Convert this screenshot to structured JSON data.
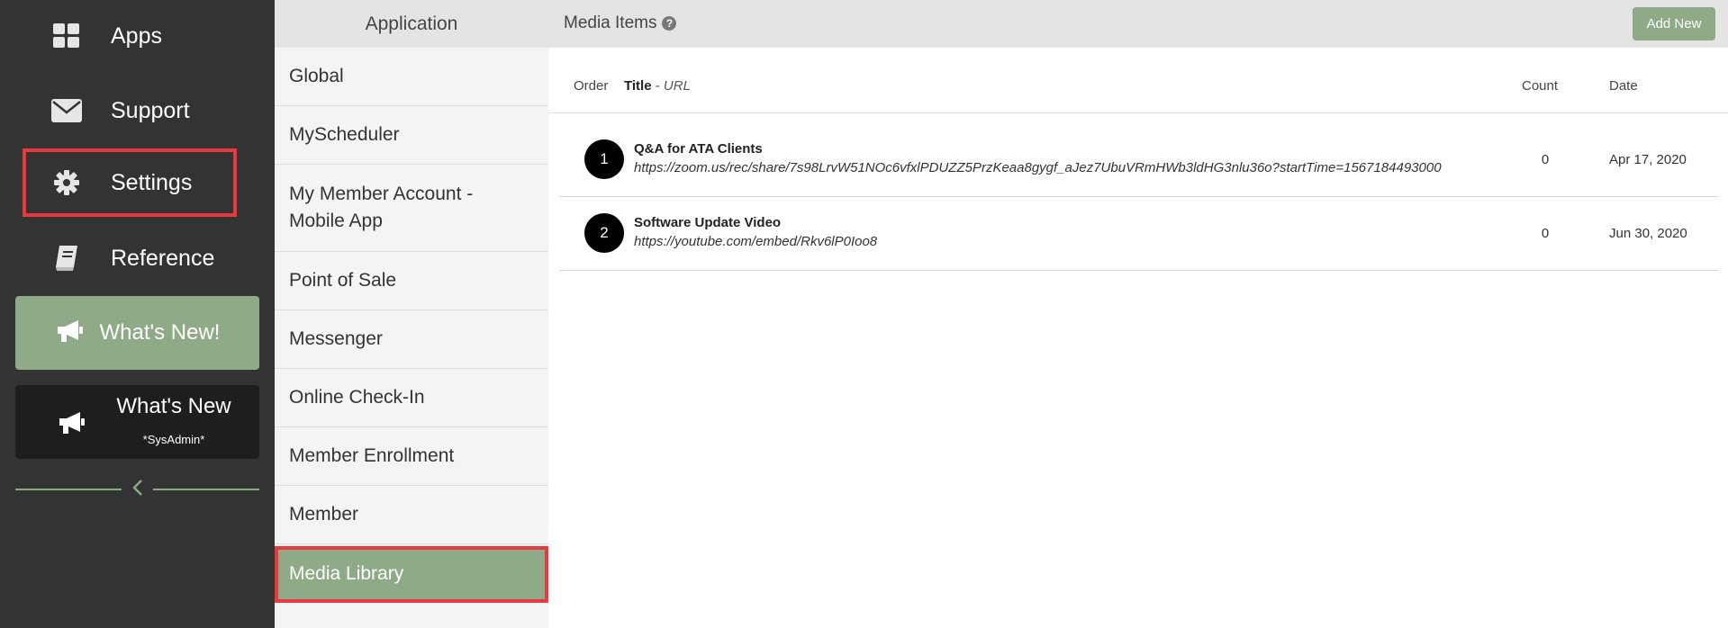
{
  "sidebar": {
    "items": [
      {
        "label": "Apps",
        "icon": "grid-icon"
      },
      {
        "label": "Support",
        "icon": "envelope-icon"
      },
      {
        "label": "Settings",
        "icon": "gear-icon"
      },
      {
        "label": "Reference",
        "icon": "book-icon"
      }
    ],
    "whats_new_button": "What's New!",
    "whats_new_admin_title": "What's New",
    "whats_new_admin_sub": "*SysAdmin*"
  },
  "app_menu": {
    "header": "Application",
    "items": [
      "Global",
      "MyScheduler",
      "My Member Account - Mobile App",
      "Point of Sale",
      "Messenger",
      "Online Check-In",
      "Member Enrollment",
      "Member",
      "Media Library"
    ],
    "active": "Media Library"
  },
  "main": {
    "title": "Media Items",
    "help_glyph": "?",
    "add_new_label": "Add New",
    "columns": {
      "order": "Order",
      "title": "Title",
      "title_sep": " - ",
      "url": "URL",
      "count": "Count",
      "date": "Date"
    },
    "rows": [
      {
        "order": "1",
        "title": "Q&A for ATA Clients",
        "url": "https://zoom.us/rec/share/7s98LrvW51NOc6vfxlPDUZZ5PrzKeaa8gygf_aJez7UbuVRmHWb3ldHG3nlu36o?startTime=1567184493000",
        "count": "0",
        "date": "Apr 17, 2020"
      },
      {
        "order": "2",
        "title": "Software Update Video",
        "url": "https://youtube.com/embed/Rkv6lP0Ioo8",
        "count": "0",
        "date": "Jun 30, 2020"
      }
    ]
  },
  "colors": {
    "sidebar_bg": "#333333",
    "accent_green": "#8faa86",
    "highlight_red": "#e8393f"
  }
}
